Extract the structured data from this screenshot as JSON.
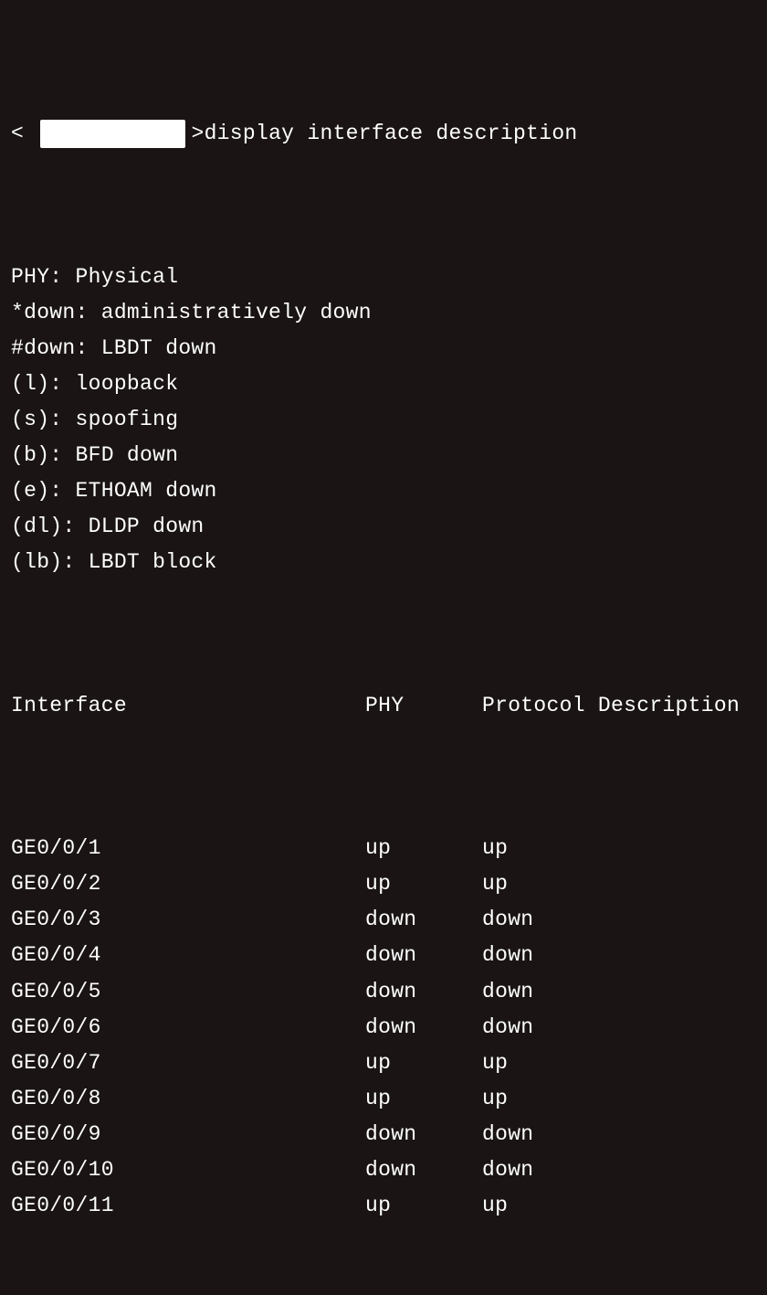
{
  "prompt": {
    "bracket_open": "<",
    "bracket_close": ">",
    "command": "display interface description"
  },
  "legend": [
    "PHY: Physical",
    "*down: administratively down",
    "#down: LBDT down",
    "(l): loopback",
    "(s): spoofing",
    "(b): BFD down",
    "(e): ETHOAM down",
    "(dl): DLDP down",
    "(lb): LBDT block"
  ],
  "table": {
    "headers": {
      "interface": "Interface",
      "phy": "PHY",
      "protocol": "Protocol Description"
    },
    "rows": [
      {
        "interface": "GE0/0/1",
        "phy": "up",
        "protocol": "up"
      },
      {
        "interface": "GE0/0/2",
        "phy": "up",
        "protocol": "up"
      },
      {
        "interface": "GE0/0/3",
        "phy": "down",
        "protocol": "down"
      },
      {
        "interface": "GE0/0/4",
        "phy": "down",
        "protocol": "down"
      },
      {
        "interface": "GE0/0/5",
        "phy": "down",
        "protocol": "down"
      },
      {
        "interface": "GE0/0/6",
        "phy": "down",
        "protocol": "down"
      },
      {
        "interface": "GE0/0/7",
        "phy": "up",
        "protocol": "up"
      },
      {
        "interface": "GE0/0/8",
        "phy": "up",
        "protocol": "up"
      },
      {
        "interface": "GE0/0/9",
        "phy": "down",
        "protocol": "down"
      },
      {
        "interface": "GE0/0/10",
        "phy": "down",
        "protocol": "down"
      },
      {
        "interface": "GE0/0/11",
        "phy": "up",
        "protocol": "up"
      }
    ]
  }
}
